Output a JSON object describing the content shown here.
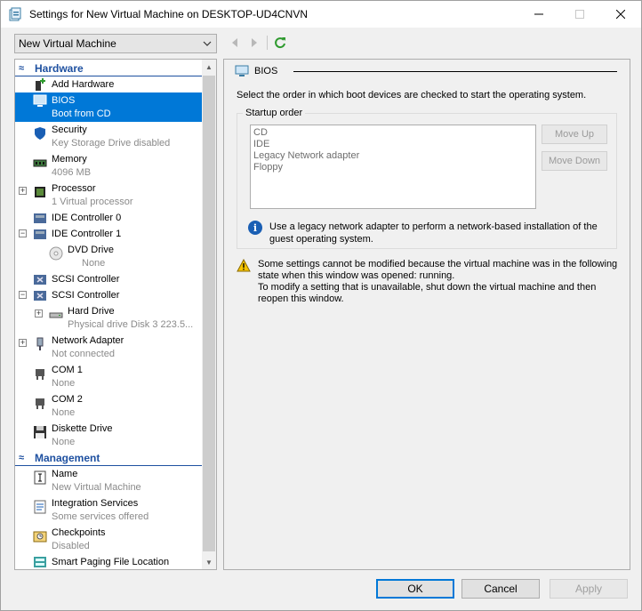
{
  "window": {
    "title": "Settings for New Virtual Machine on DESKTOP-UD4CNVN"
  },
  "vm_select": {
    "value": "New Virtual Machine"
  },
  "tree": {
    "hardware_header": "Hardware",
    "management_header": "Management",
    "hardware_items": [
      {
        "name": "Add Hardware",
        "sub": ""
      },
      {
        "name": "BIOS",
        "sub": "Boot from CD"
      },
      {
        "name": "Security",
        "sub": "Key Storage Drive disabled"
      },
      {
        "name": "Memory",
        "sub": "4096 MB"
      },
      {
        "name": "Processor",
        "sub": "1 Virtual processor"
      },
      {
        "name": "IDE Controller 0",
        "sub": ""
      },
      {
        "name": "IDE Controller 1",
        "sub": ""
      },
      {
        "name": "DVD Drive",
        "sub": "None"
      },
      {
        "name": "SCSI Controller",
        "sub": ""
      },
      {
        "name": "SCSI Controller",
        "sub": ""
      },
      {
        "name": "Hard Drive",
        "sub": "Physical drive Disk 3 223.5..."
      },
      {
        "name": "Network Adapter",
        "sub": "Not connected"
      },
      {
        "name": "COM 1",
        "sub": "None"
      },
      {
        "name": "COM 2",
        "sub": "None"
      },
      {
        "name": "Diskette Drive",
        "sub": "None"
      }
    ],
    "management_items": [
      {
        "name": "Name",
        "sub": "New Virtual Machine"
      },
      {
        "name": "Integration Services",
        "sub": "Some services offered"
      },
      {
        "name": "Checkpoints",
        "sub": "Disabled"
      },
      {
        "name": "Smart Paging File Location",
        "sub": ""
      }
    ]
  },
  "bios": {
    "title": "BIOS",
    "description": "Select the order in which boot devices are checked to start the operating system.",
    "startup_order_label": "Startup order",
    "boot_devices": [
      "CD",
      "IDE",
      "Legacy Network adapter",
      "Floppy"
    ],
    "move_up": "Move Up",
    "move_down": "Move Down",
    "info_text_1": "Use a legacy network adapter to perform a network-based installation of the",
    "info_text_2": "guest operating system.",
    "warning_1": "Some settings cannot be modified because the virtual machine was in the following",
    "warning_2": "state when this window was opened: running.",
    "warning_3": "To modify a setting that is unavailable, shut down the virtual machine and then",
    "warning_4": "reopen this window."
  },
  "buttons": {
    "ok": "OK",
    "cancel": "Cancel",
    "apply": "Apply"
  },
  "colors": {
    "selection": "#0078d7",
    "section_header": "#1e50a0"
  }
}
